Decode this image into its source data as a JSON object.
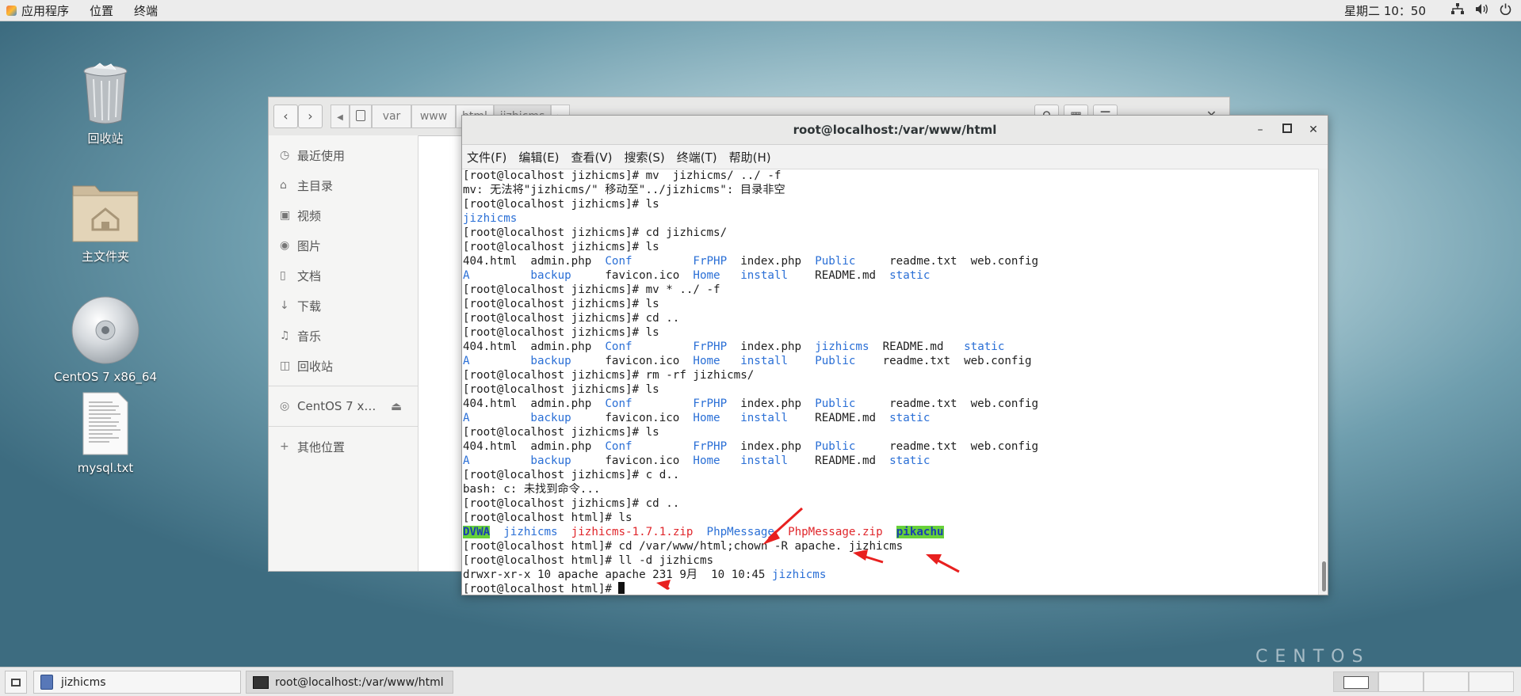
{
  "topbar": {
    "apps_label": "应用程序",
    "places_label": "位置",
    "terminal_label": "终端",
    "clock": "星期二 10：50"
  },
  "desktop": {
    "icons": [
      {
        "label": "回收站",
        "icon": "trash-icon"
      },
      {
        "label": "主文件夹",
        "icon": "home-folder-icon"
      },
      {
        "label": "CentOS 7 x86_64",
        "icon": "disc-icon"
      },
      {
        "label": "mysql.txt",
        "icon": "text-file-icon"
      }
    ],
    "watermark": "CENTOS"
  },
  "file_manager": {
    "breadcrumbs": [
      "var",
      "www",
      "html",
      "jizhicms"
    ],
    "sidebar": [
      {
        "label": "最近使用",
        "icon": "clock-icon"
      },
      {
        "label": "主目录",
        "icon": "home-icon"
      },
      {
        "label": "视频",
        "icon": "video-icon"
      },
      {
        "label": "图片",
        "icon": "camera-icon"
      },
      {
        "label": "文档",
        "icon": "document-icon"
      },
      {
        "label": "下载",
        "icon": "download-icon"
      },
      {
        "label": "音乐",
        "icon": "music-icon"
      },
      {
        "label": "回收站",
        "icon": "trash-icon"
      },
      {
        "label": "CentOS 7 x…",
        "icon": "disc-icon"
      },
      {
        "label": "其他位置",
        "icon": "plus-icon"
      }
    ]
  },
  "terminal": {
    "title": "root@localhost:/var/www/html",
    "menu": [
      "文件(F)",
      "编辑(E)",
      "查看(V)",
      "搜索(S)",
      "终端(T)",
      "帮助(H)"
    ],
    "lines": [
      [
        {
          "t": "[root@localhost jizhicms]# mv  jizhicms/ ../ -f"
        }
      ],
      [
        {
          "t": "mv: 无法将\"jizhicms/\" 移动至\"../jizhicms\": 目录非空"
        }
      ],
      [
        {
          "t": "[root@localhost jizhicms]# ls"
        }
      ],
      [
        {
          "t": "jizhicms",
          "c": "blue"
        }
      ],
      [
        {
          "t": "[root@localhost jizhicms]# cd jizhicms/"
        }
      ],
      [
        {
          "t": "[root@localhost jizhicms]# ls"
        }
      ],
      [
        {
          "t": "404.html  admin.php  "
        },
        {
          "t": "Conf",
          "c": "blue"
        },
        {
          "t": "         "
        },
        {
          "t": "FrPHP",
          "c": "blue"
        },
        {
          "t": "  index.php  "
        },
        {
          "t": "Public",
          "c": "blue"
        },
        {
          "t": "     readme.txt  web.config"
        }
      ],
      [
        {
          "t": "A",
          "c": "blue"
        },
        {
          "t": "         "
        },
        {
          "t": "backup",
          "c": "blue"
        },
        {
          "t": "     favicon.ico  "
        },
        {
          "t": "Home",
          "c": "blue"
        },
        {
          "t": "   "
        },
        {
          "t": "install",
          "c": "blue"
        },
        {
          "t": "    README.md  "
        },
        {
          "t": "static",
          "c": "blue"
        }
      ],
      [
        {
          "t": "[root@localhost jizhicms]# mv * ../ -f"
        }
      ],
      [
        {
          "t": "[root@localhost jizhicms]# ls"
        }
      ],
      [
        {
          "t": "[root@localhost jizhicms]# cd .."
        }
      ],
      [
        {
          "t": "[root@localhost jizhicms]# ls"
        }
      ],
      [
        {
          "t": "404.html  admin.php  "
        },
        {
          "t": "Conf",
          "c": "blue"
        },
        {
          "t": "         "
        },
        {
          "t": "FrPHP",
          "c": "blue"
        },
        {
          "t": "  index.php  "
        },
        {
          "t": "jizhicms",
          "c": "blue"
        },
        {
          "t": "  README.md   "
        },
        {
          "t": "static",
          "c": "blue"
        }
      ],
      [
        {
          "t": "A",
          "c": "blue"
        },
        {
          "t": "         "
        },
        {
          "t": "backup",
          "c": "blue"
        },
        {
          "t": "     favicon.ico  "
        },
        {
          "t": "Home",
          "c": "blue"
        },
        {
          "t": "   "
        },
        {
          "t": "install",
          "c": "blue"
        },
        {
          "t": "    "
        },
        {
          "t": "Public",
          "c": "blue"
        },
        {
          "t": "    readme.txt  web.config"
        }
      ],
      [
        {
          "t": "[root@localhost jizhicms]# rm -rf jizhicms/"
        }
      ],
      [
        {
          "t": "[root@localhost jizhicms]# ls"
        }
      ],
      [
        {
          "t": "404.html  admin.php  "
        },
        {
          "t": "Conf",
          "c": "blue"
        },
        {
          "t": "         "
        },
        {
          "t": "FrPHP",
          "c": "blue"
        },
        {
          "t": "  index.php  "
        },
        {
          "t": "Public",
          "c": "blue"
        },
        {
          "t": "     readme.txt  web.config"
        }
      ],
      [
        {
          "t": "A",
          "c": "blue"
        },
        {
          "t": "         "
        },
        {
          "t": "backup",
          "c": "blue"
        },
        {
          "t": "     favicon.ico  "
        },
        {
          "t": "Home",
          "c": "blue"
        },
        {
          "t": "   "
        },
        {
          "t": "install",
          "c": "blue"
        },
        {
          "t": "    README.md  "
        },
        {
          "t": "static",
          "c": "blue"
        }
      ],
      [
        {
          "t": "[root@localhost jizhicms]# ls"
        }
      ],
      [
        {
          "t": "404.html  admin.php  "
        },
        {
          "t": "Conf",
          "c": "blue"
        },
        {
          "t": "         "
        },
        {
          "t": "FrPHP",
          "c": "blue"
        },
        {
          "t": "  index.php  "
        },
        {
          "t": "Public",
          "c": "blue"
        },
        {
          "t": "     readme.txt  web.config"
        }
      ],
      [
        {
          "t": "A",
          "c": "blue"
        },
        {
          "t": "         "
        },
        {
          "t": "backup",
          "c": "blue"
        },
        {
          "t": "     favicon.ico  "
        },
        {
          "t": "Home",
          "c": "blue"
        },
        {
          "t": "   "
        },
        {
          "t": "install",
          "c": "blue"
        },
        {
          "t": "    README.md  "
        },
        {
          "t": "static",
          "c": "blue"
        }
      ],
      [
        {
          "t": "[root@localhost jizhicms]# c d.."
        }
      ],
      [
        {
          "t": "bash: c: 未找到命令..."
        }
      ],
      [
        {
          "t": "[root@localhost jizhicms]# cd .."
        }
      ],
      [
        {
          "t": "[root@localhost html]# ls"
        }
      ],
      [
        {
          "t": "DVWA",
          "c": "hl"
        },
        {
          "t": "  "
        },
        {
          "t": "jizhicms",
          "c": "blue"
        },
        {
          "t": "  "
        },
        {
          "t": "jizhicms-1.7.1.zip",
          "c": "red"
        },
        {
          "t": "  "
        },
        {
          "t": "PhpMessage",
          "c": "blue"
        },
        {
          "t": "  "
        },
        {
          "t": "PhpMessage.zip",
          "c": "red"
        },
        {
          "t": "  "
        },
        {
          "t": "pikachu",
          "c": "hl"
        }
      ],
      [
        {
          "t": "[root@localhost html]# cd /var/www/html;chown -R apache. jizhicms"
        }
      ],
      [
        {
          "t": "[root@localhost html]# ll -d jizhicms"
        }
      ],
      [
        {
          "t": "drwxr-xr-x 10 apache apache 231 9月  10 10:45 "
        },
        {
          "t": "jizhicms",
          "c": "blue"
        }
      ],
      [
        {
          "t": "[root@localhost html]# "
        },
        {
          "cursor": true
        }
      ]
    ]
  },
  "taskbar": {
    "tasks": [
      {
        "label": "jizhicms",
        "icon": "file-manager-icon"
      },
      {
        "label": "root@localhost:/var/www/html",
        "icon": "terminal-icon"
      }
    ]
  },
  "colors": {
    "term_blue": "#2a6fd6",
    "term_red": "#e0262b",
    "term_highlight": "#67d13a",
    "annotation_arrow": "#e8201f"
  }
}
